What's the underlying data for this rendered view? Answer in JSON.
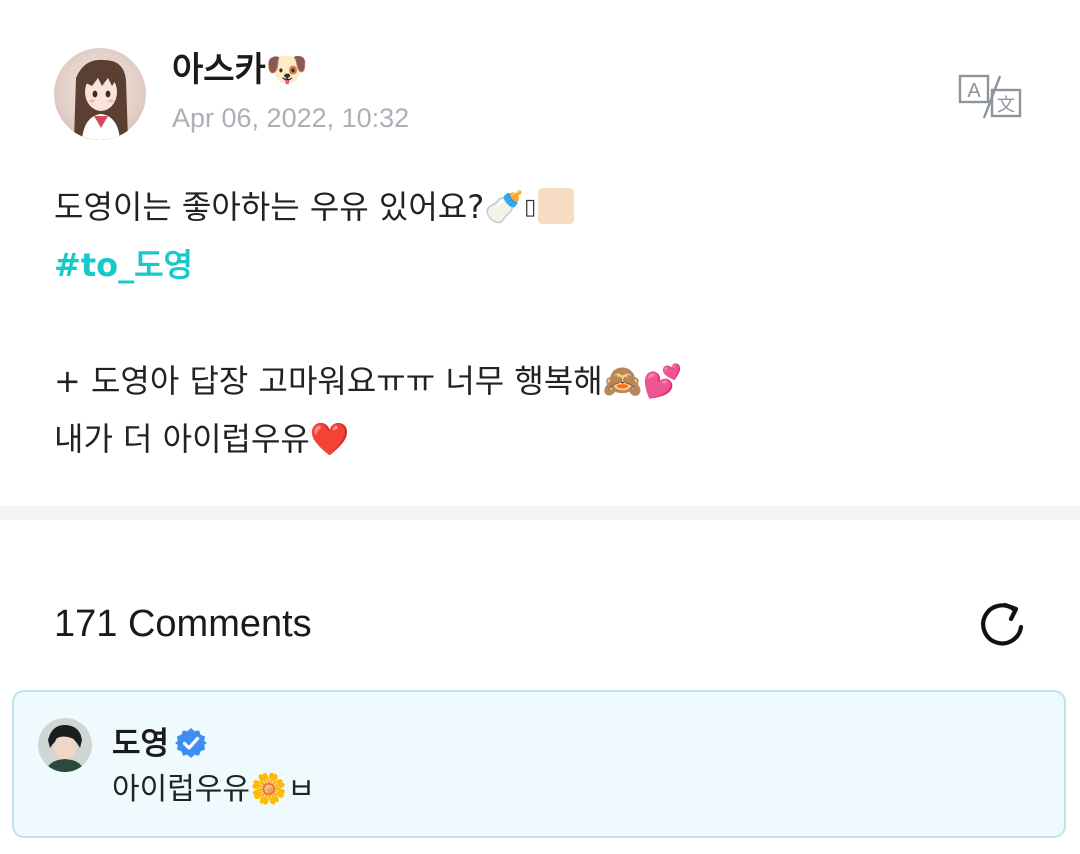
{
  "post": {
    "author": {
      "name": "아스카",
      "name_emoji": "🐶",
      "avatar_icon": "anime-girl-avatar"
    },
    "date": "Apr 06, 2022, 10:32",
    "translate_icon": "translate-icon",
    "body": {
      "line1_text": "도영이는 좋아하는 우유 있어요?",
      "line1_emoji_bottle": "🍼",
      "line1_tofu": "▯",
      "hashtag": "#to_도영",
      "line3_text": "+ 도영아 답장 고마워요ㅠㅠ 너무 행복해",
      "line3_emoji_monkey": "🙈",
      "line3_emoji_hearts": "💕",
      "line4_text": "내가 더 아이럽우유",
      "line4_emoji_heart": "❤️"
    }
  },
  "comments": {
    "count_label": "171 Comments",
    "refresh_icon": "refresh-icon",
    "highlighted": {
      "author": "도영",
      "verified_icon": "verified-badge-icon",
      "text": "아이럽우유",
      "text_emoji": "🌼",
      "text_suffix": "ㅂ"
    }
  },
  "colors": {
    "hashtag": "#19c9c9",
    "date": "#aab0b6",
    "divider": "#f1f3f5",
    "comment_bg": "#eefafd",
    "comment_border": "#bfe3ea",
    "verified": "#3d8ef0"
  }
}
